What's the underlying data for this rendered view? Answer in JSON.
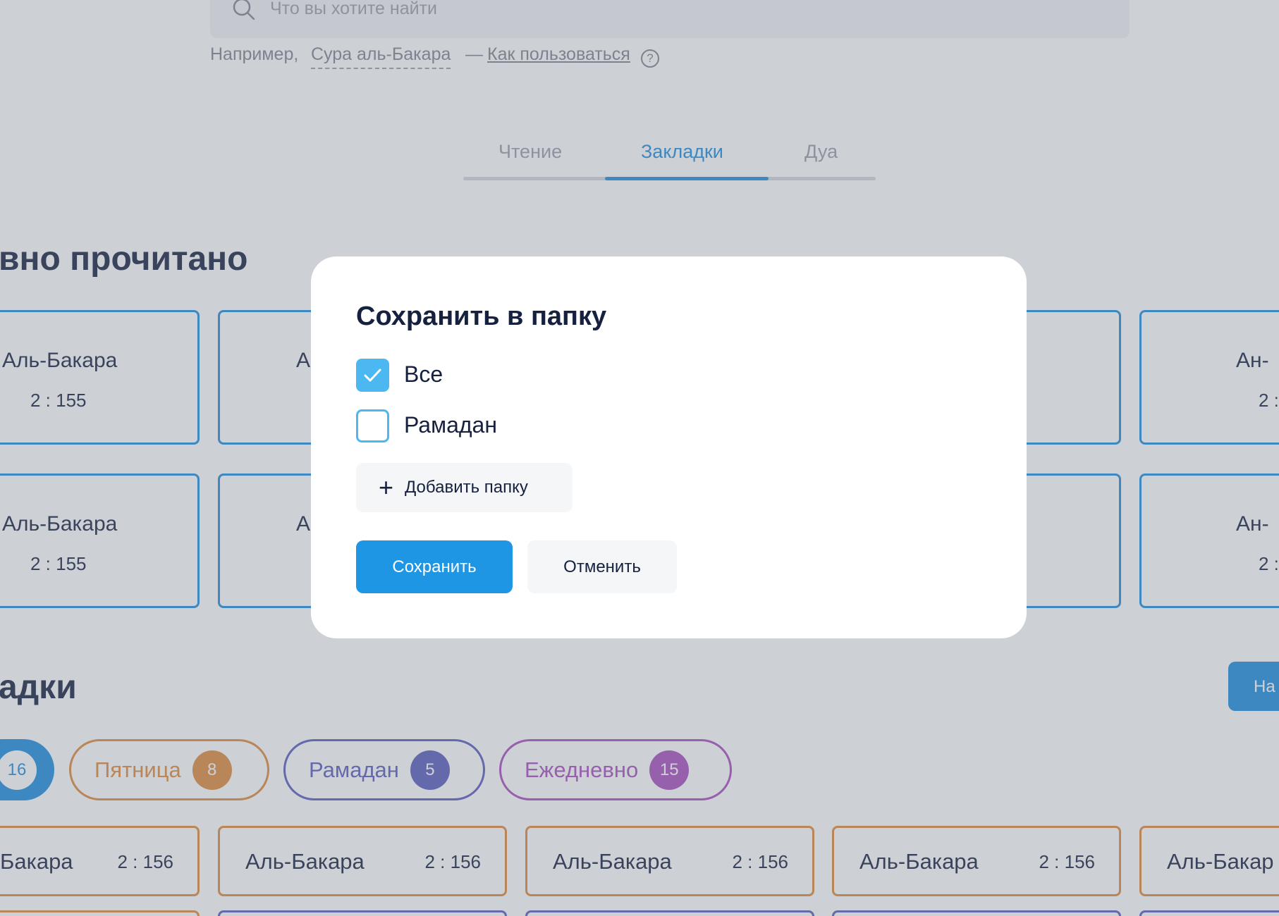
{
  "search": {
    "placeholder": "Что вы хотите найти",
    "hint_example": "Например,",
    "hint_sura": "Сура аль-Бакара",
    "hint_dash": "—",
    "hint_how": "Как пользоваться",
    "help_icon": "?"
  },
  "tabs": [
    {
      "label": "Чтение"
    },
    {
      "label": "Закладки",
      "active": true
    },
    {
      "label": "Дуа"
    }
  ],
  "recent": {
    "title": "вно прочитано",
    "cards": [
      {
        "name": "Аль-Бакара",
        "ref": "2 : 155"
      },
      {
        "name": "А",
        "ref": ""
      },
      {
        "name": "Ан-",
        "ref": "2 :"
      },
      {
        "name": "Аль-Бакара",
        "ref": "2 : 155"
      },
      {
        "name": "А",
        "ref": ""
      },
      {
        "name": "Ан-",
        "ref": "2 :"
      }
    ]
  },
  "bookmarks": {
    "title": "адки",
    "button_label": "На",
    "chips": [
      {
        "label": "",
        "count": "16"
      },
      {
        "label": "Пятница",
        "count": "8"
      },
      {
        "label": "Рамадан",
        "count": "5"
      },
      {
        "label": "Ежедневно",
        "count": "15"
      }
    ],
    "cards": [
      {
        "name": "Бакара",
        "ref": "2 : 156"
      },
      {
        "name": "Аль-Бакара",
        "ref": "2 : 156"
      },
      {
        "name": "Аль-Бакара",
        "ref": "2 : 156"
      },
      {
        "name": "Аль-Бакара",
        "ref": "2 : 156"
      },
      {
        "name": "Аль-Бакар",
        "ref": ""
      }
    ]
  },
  "modal": {
    "title": "Сохранить в папку",
    "folders": [
      {
        "label": "Все",
        "checked": true
      },
      {
        "label": "Рамадан",
        "checked": false
      }
    ],
    "add_folder_label": "Добавить папку",
    "save_label": "Сохранить",
    "cancel_label": "Отменить"
  },
  "colors": {
    "accent": "#1e8ee0",
    "friday": "#e08a3b",
    "ramadan": "#5a5cbd",
    "daily": "#a94fbf",
    "checkbox": "#4cb8f2",
    "text_dark": "#16203f"
  }
}
